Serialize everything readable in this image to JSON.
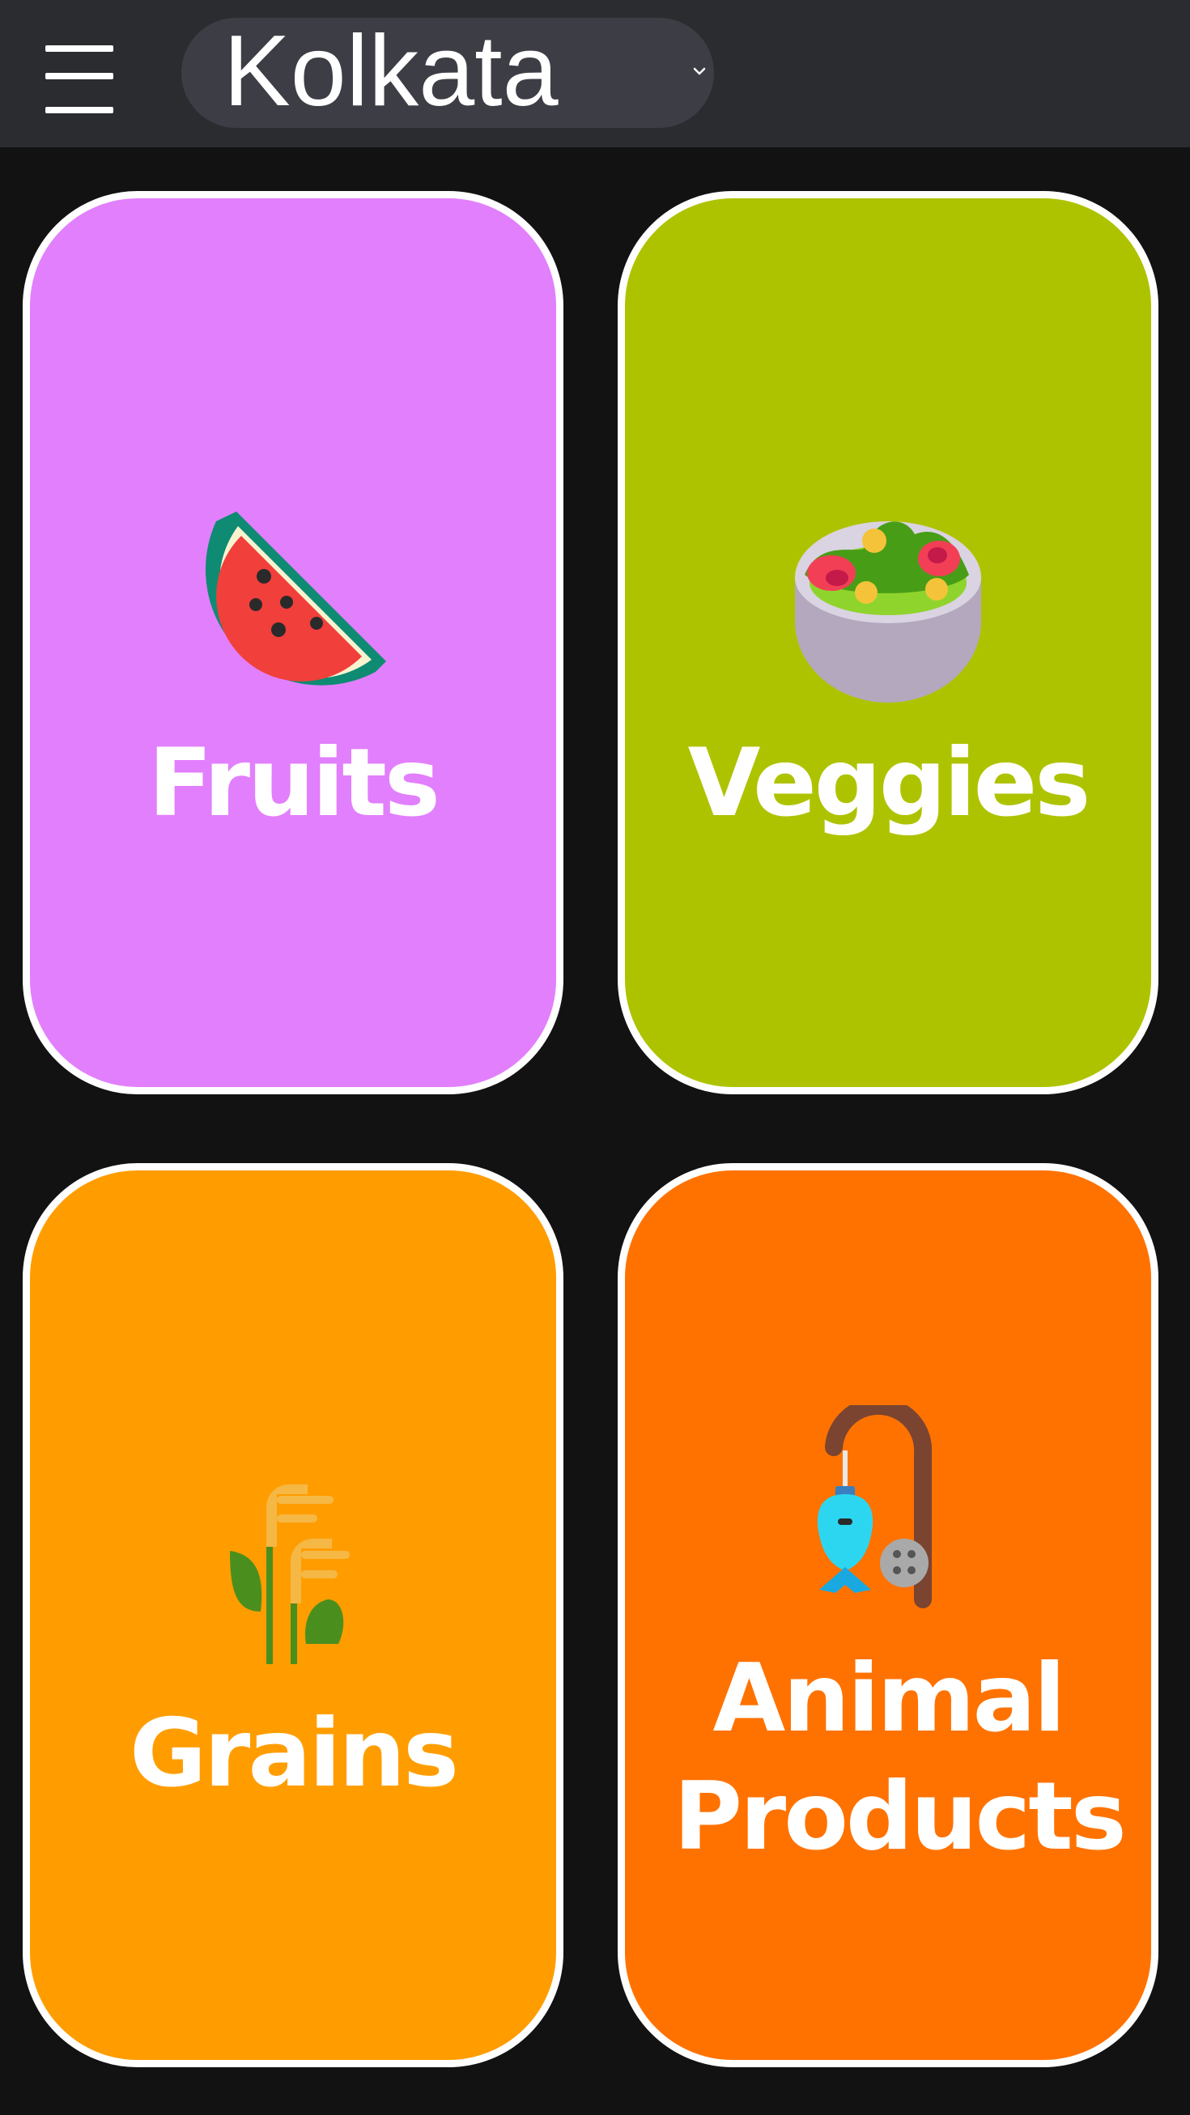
{
  "header": {
    "city": "Kolkata"
  },
  "icons": {
    "menu": "hamburger-menu-icon",
    "dropdown": "chevron-down-icon"
  },
  "categories": [
    {
      "label": "Fruits",
      "icon": "watermelon-icon",
      "color": "#e27ffc"
    },
    {
      "label": "Veggies",
      "icon": "salad-bowl-icon",
      "color": "#aec300"
    },
    {
      "label": "Grains",
      "icon": "wheat-icon",
      "color": "#ff9d00"
    },
    {
      "label": "Animal Products",
      "icon": "fishing-rod-icon",
      "color": "#ff7200"
    }
  ]
}
